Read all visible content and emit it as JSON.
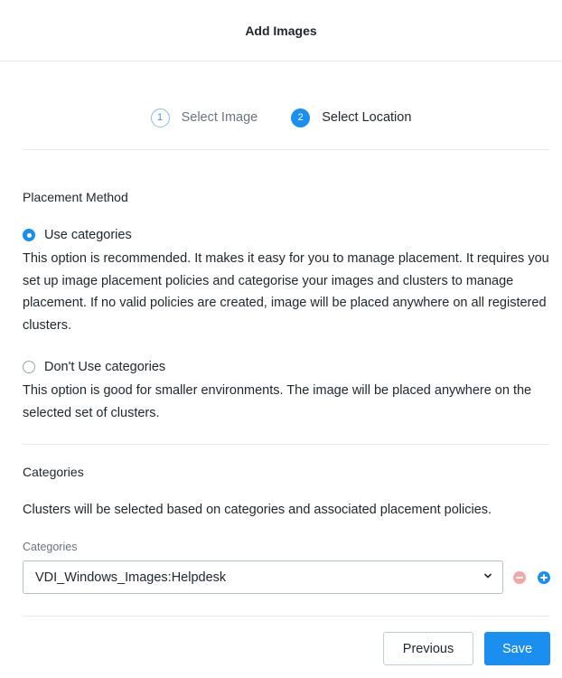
{
  "header": {
    "title": "Add Images"
  },
  "wizard": {
    "steps": [
      {
        "number": "1",
        "label": "Select Image",
        "active": false
      },
      {
        "number": "2",
        "label": "Select Location",
        "active": true
      }
    ]
  },
  "placement": {
    "title": "Placement Method",
    "options": [
      {
        "label": "Use categories",
        "checked": true,
        "description": "This option is recommended. It makes it easy for you to manage placement. It requires you set up image placement policies and categorise your images and clusters to manage placement. If no valid policies are created, image will be placed anywhere on all registered clusters."
      },
      {
        "label": "Don't Use categories",
        "checked": false,
        "description": "This option is good for smaller environments. The image will be placed anywhere on the selected set of clusters."
      }
    ]
  },
  "categories": {
    "title": "Categories",
    "description": "Clusters will be selected based on categories and associated placement policies.",
    "field_label": "Categories",
    "selected_value": "VDI_Windows_Images:Helpdesk"
  },
  "footer": {
    "previous_label": "Previous",
    "save_label": "Save"
  },
  "colors": {
    "accent": "#1b8ff0",
    "remove": "#f1a8a8"
  },
  "icons": [
    "chevron-down-icon",
    "remove-icon",
    "add-icon"
  ]
}
